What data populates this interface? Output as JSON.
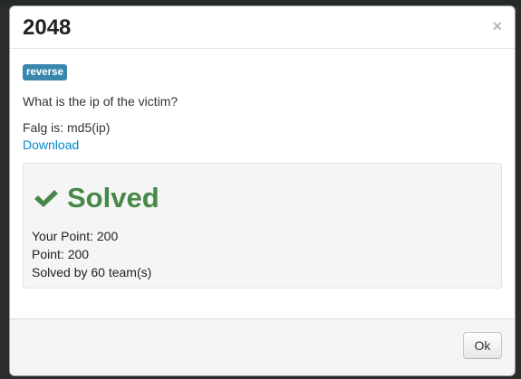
{
  "modal": {
    "title": "2048",
    "close_label": "×",
    "tag": "reverse",
    "question": "What is the ip of the victim?",
    "flag_format": "Falg is: md5(ip)",
    "download_label": "Download",
    "status": {
      "label": "Solved",
      "icon": "checkmark-icon",
      "your_point": "Your Point: 200",
      "point": "Point: 200",
      "solved_by": "Solved by 60 team(s)"
    },
    "ok_label": "Ok"
  },
  "colors": {
    "tag_bg": "#3a87ad",
    "solved_green": "#468847",
    "link_blue": "#0088cc"
  }
}
